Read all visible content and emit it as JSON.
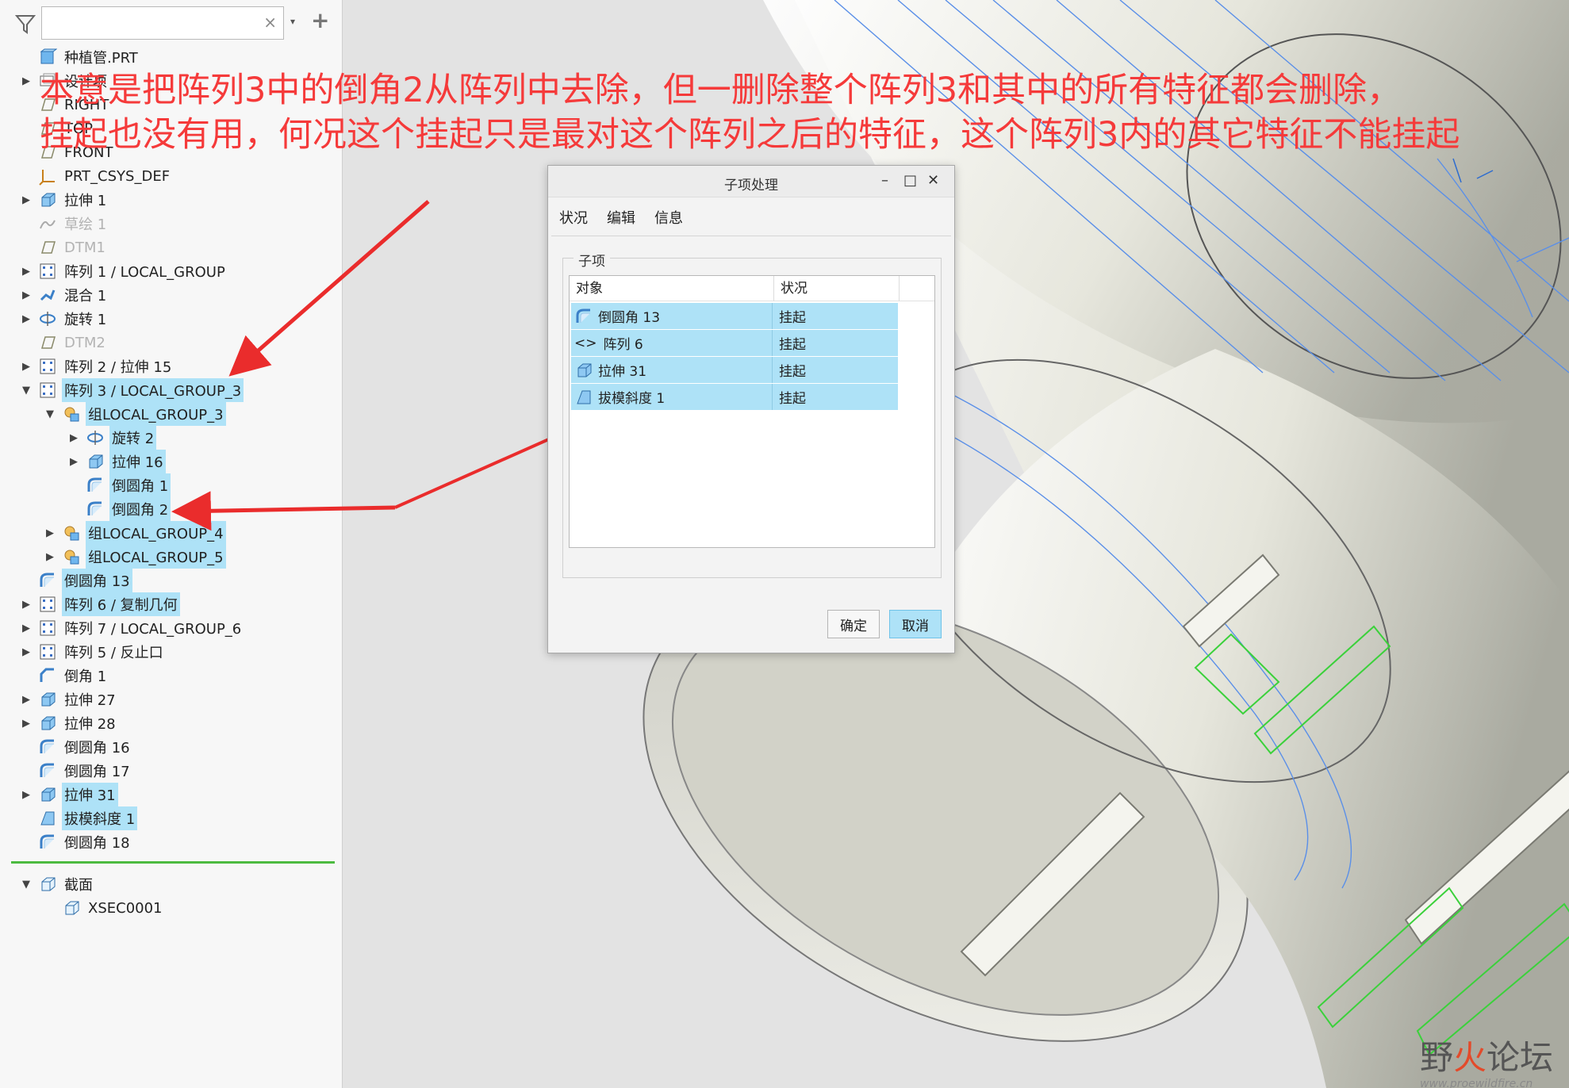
{
  "search": {
    "placeholder": "",
    "clear_glyph": "×",
    "dropdown_glyph": "▾",
    "add_glyph": "+"
  },
  "tree": {
    "items": [
      {
        "label": "种植管.PRT",
        "icon": "part-icon",
        "toggle": "",
        "indent": 0,
        "selected": false,
        "dim": false
      },
      {
        "label": "设计项",
        "icon": "layer-icon",
        "toggle": "▶",
        "indent": 0,
        "selected": false,
        "dim": false
      },
      {
        "label": "RIGHT",
        "icon": "datum-plane-icon",
        "toggle": "",
        "indent": 0,
        "selected": false,
        "dim": false
      },
      {
        "label": "TOP",
        "icon": "datum-plane-icon",
        "toggle": "",
        "indent": 0,
        "selected": false,
        "dim": false
      },
      {
        "label": "FRONT",
        "icon": "datum-plane-icon",
        "toggle": "",
        "indent": 0,
        "selected": false,
        "dim": false
      },
      {
        "label": "PRT_CSYS_DEF",
        "icon": "csys-icon",
        "toggle": "",
        "indent": 0,
        "selected": false,
        "dim": false
      },
      {
        "label": "拉伸 1",
        "icon": "extrude-icon",
        "toggle": "▶",
        "indent": 0,
        "selected": false,
        "dim": false
      },
      {
        "label": "草绘 1",
        "icon": "sketch-icon",
        "toggle": "",
        "indent": 0,
        "selected": false,
        "dim": true
      },
      {
        "label": "DTM1",
        "icon": "datum-plane-icon",
        "toggle": "",
        "indent": 0,
        "selected": false,
        "dim": true
      },
      {
        "label": "阵列 1 / LOCAL_GROUP",
        "icon": "pattern-icon",
        "toggle": "▶",
        "indent": 0,
        "selected": false,
        "dim": false
      },
      {
        "label": "混合 1",
        "icon": "blend-icon",
        "toggle": "▶",
        "indent": 0,
        "selected": false,
        "dim": false
      },
      {
        "label": "旋转 1",
        "icon": "revolve-icon",
        "toggle": "▶",
        "indent": 0,
        "selected": false,
        "dim": false
      },
      {
        "label": "DTM2",
        "icon": "datum-plane-icon",
        "toggle": "",
        "indent": 0,
        "selected": false,
        "dim": true
      },
      {
        "label": "阵列 2 / 拉伸 15",
        "icon": "pattern-icon",
        "toggle": "▶",
        "indent": 0,
        "selected": false,
        "dim": false
      },
      {
        "label": "阵列 3 / LOCAL_GROUP_3",
        "icon": "pattern-icon",
        "toggle": "▼",
        "indent": 0,
        "selected": true,
        "dim": false
      },
      {
        "label": "组LOCAL_GROUP_3",
        "icon": "group-icon",
        "toggle": "▼",
        "indent": 1,
        "selected": true,
        "dim": false
      },
      {
        "label": "旋转 2",
        "icon": "revolve-icon",
        "toggle": "▶",
        "indent": 2,
        "selected": true,
        "dim": false
      },
      {
        "label": "拉伸 16",
        "icon": "extrude-icon",
        "toggle": "▶",
        "indent": 2,
        "selected": true,
        "dim": false
      },
      {
        "label": "倒圆角 1",
        "icon": "round-icon",
        "toggle": "",
        "indent": 2,
        "selected": true,
        "dim": false
      },
      {
        "label": "倒圆角 2",
        "icon": "round-icon",
        "toggle": "",
        "indent": 2,
        "selected": true,
        "dim": false
      },
      {
        "label": "组LOCAL_GROUP_4",
        "icon": "group-icon",
        "toggle": "▶",
        "indent": 1,
        "selected": true,
        "dim": false
      },
      {
        "label": "组LOCAL_GROUP_5",
        "icon": "group-icon",
        "toggle": "▶",
        "indent": 1,
        "selected": true,
        "dim": false
      },
      {
        "label": "倒圆角 13",
        "icon": "round-icon",
        "toggle": "",
        "indent": 0,
        "selected": true,
        "dim": false
      },
      {
        "label": "阵列 6 / 复制几何",
        "icon": "pattern-icon",
        "toggle": "▶",
        "indent": 0,
        "selected": true,
        "dim": false
      },
      {
        "label": "阵列 7 / LOCAL_GROUP_6",
        "icon": "pattern-icon",
        "toggle": "▶",
        "indent": 0,
        "selected": false,
        "dim": false
      },
      {
        "label": "阵列 5 / 反止口",
        "icon": "pattern-icon",
        "toggle": "▶",
        "indent": 0,
        "selected": false,
        "dim": false
      },
      {
        "label": "倒角 1",
        "icon": "chamfer-icon",
        "toggle": "",
        "indent": 0,
        "selected": false,
        "dim": false
      },
      {
        "label": "拉伸 27",
        "icon": "extrude-icon",
        "toggle": "▶",
        "indent": 0,
        "selected": false,
        "dim": false
      },
      {
        "label": "拉伸 28",
        "icon": "extrude-icon",
        "toggle": "▶",
        "indent": 0,
        "selected": false,
        "dim": false
      },
      {
        "label": "倒圆角 16",
        "icon": "round-icon",
        "toggle": "",
        "indent": 0,
        "selected": false,
        "dim": false
      },
      {
        "label": "倒圆角 17",
        "icon": "round-icon",
        "toggle": "",
        "indent": 0,
        "selected": false,
        "dim": false
      },
      {
        "label": "拉伸 31",
        "icon": "extrude-icon",
        "toggle": "▶",
        "indent": 0,
        "selected": true,
        "dim": false
      },
      {
        "label": "拔模斜度 1",
        "icon": "draft-icon",
        "toggle": "",
        "indent": 0,
        "selected": true,
        "dim": false
      },
      {
        "label": "倒圆角 18",
        "icon": "round-icon",
        "toggle": "",
        "indent": 0,
        "selected": false,
        "dim": false
      }
    ],
    "sections": [
      {
        "label": "截面",
        "icon": "section-icon",
        "toggle": "▼",
        "indent": 0
      },
      {
        "label": "XSEC0001",
        "icon": "section-icon",
        "toggle": "",
        "indent": 1
      }
    ]
  },
  "annotation": {
    "line1": "本意是把阵列3中的倒角2从阵列中去除，但一删除整个阵列3和其中的所有特征都会删除，",
    "line2": "挂起也没有用，何况这个挂起只是最对这个阵列之后的特征，这个阵列3内的其它特征不能挂起",
    "color": "#f53a3a"
  },
  "dialog": {
    "title": "子项处理",
    "menu": [
      "状况",
      "编辑",
      "信息"
    ],
    "group_label": "子项",
    "columns": [
      "对象",
      "状况"
    ],
    "rows": [
      {
        "object": "倒圆角 13",
        "status": "挂起",
        "icon": "round-icon",
        "prefix": ""
      },
      {
        "object": "阵列 6",
        "status": "挂起",
        "icon": "",
        "prefix": "<>"
      },
      {
        "object": "拉伸 31",
        "status": "挂起",
        "icon": "extrude-icon",
        "prefix": ""
      },
      {
        "object": "拔模斜度 1",
        "status": "挂起",
        "icon": "draft-icon",
        "prefix": ""
      }
    ],
    "ok_label": "确定",
    "cancel_label": "取消",
    "minimize_glyph": "–",
    "maximize_glyph": "□",
    "close_glyph": "✕"
  },
  "watermark": {
    "title_a": "野",
    "title_b": "火",
    "title_c": "论坛",
    "url": "www.proewildfire.cn"
  },
  "colors": {
    "selection": "#aee2f7",
    "annotation_red": "#f53a3a",
    "divider_green": "#4cbb40"
  }
}
